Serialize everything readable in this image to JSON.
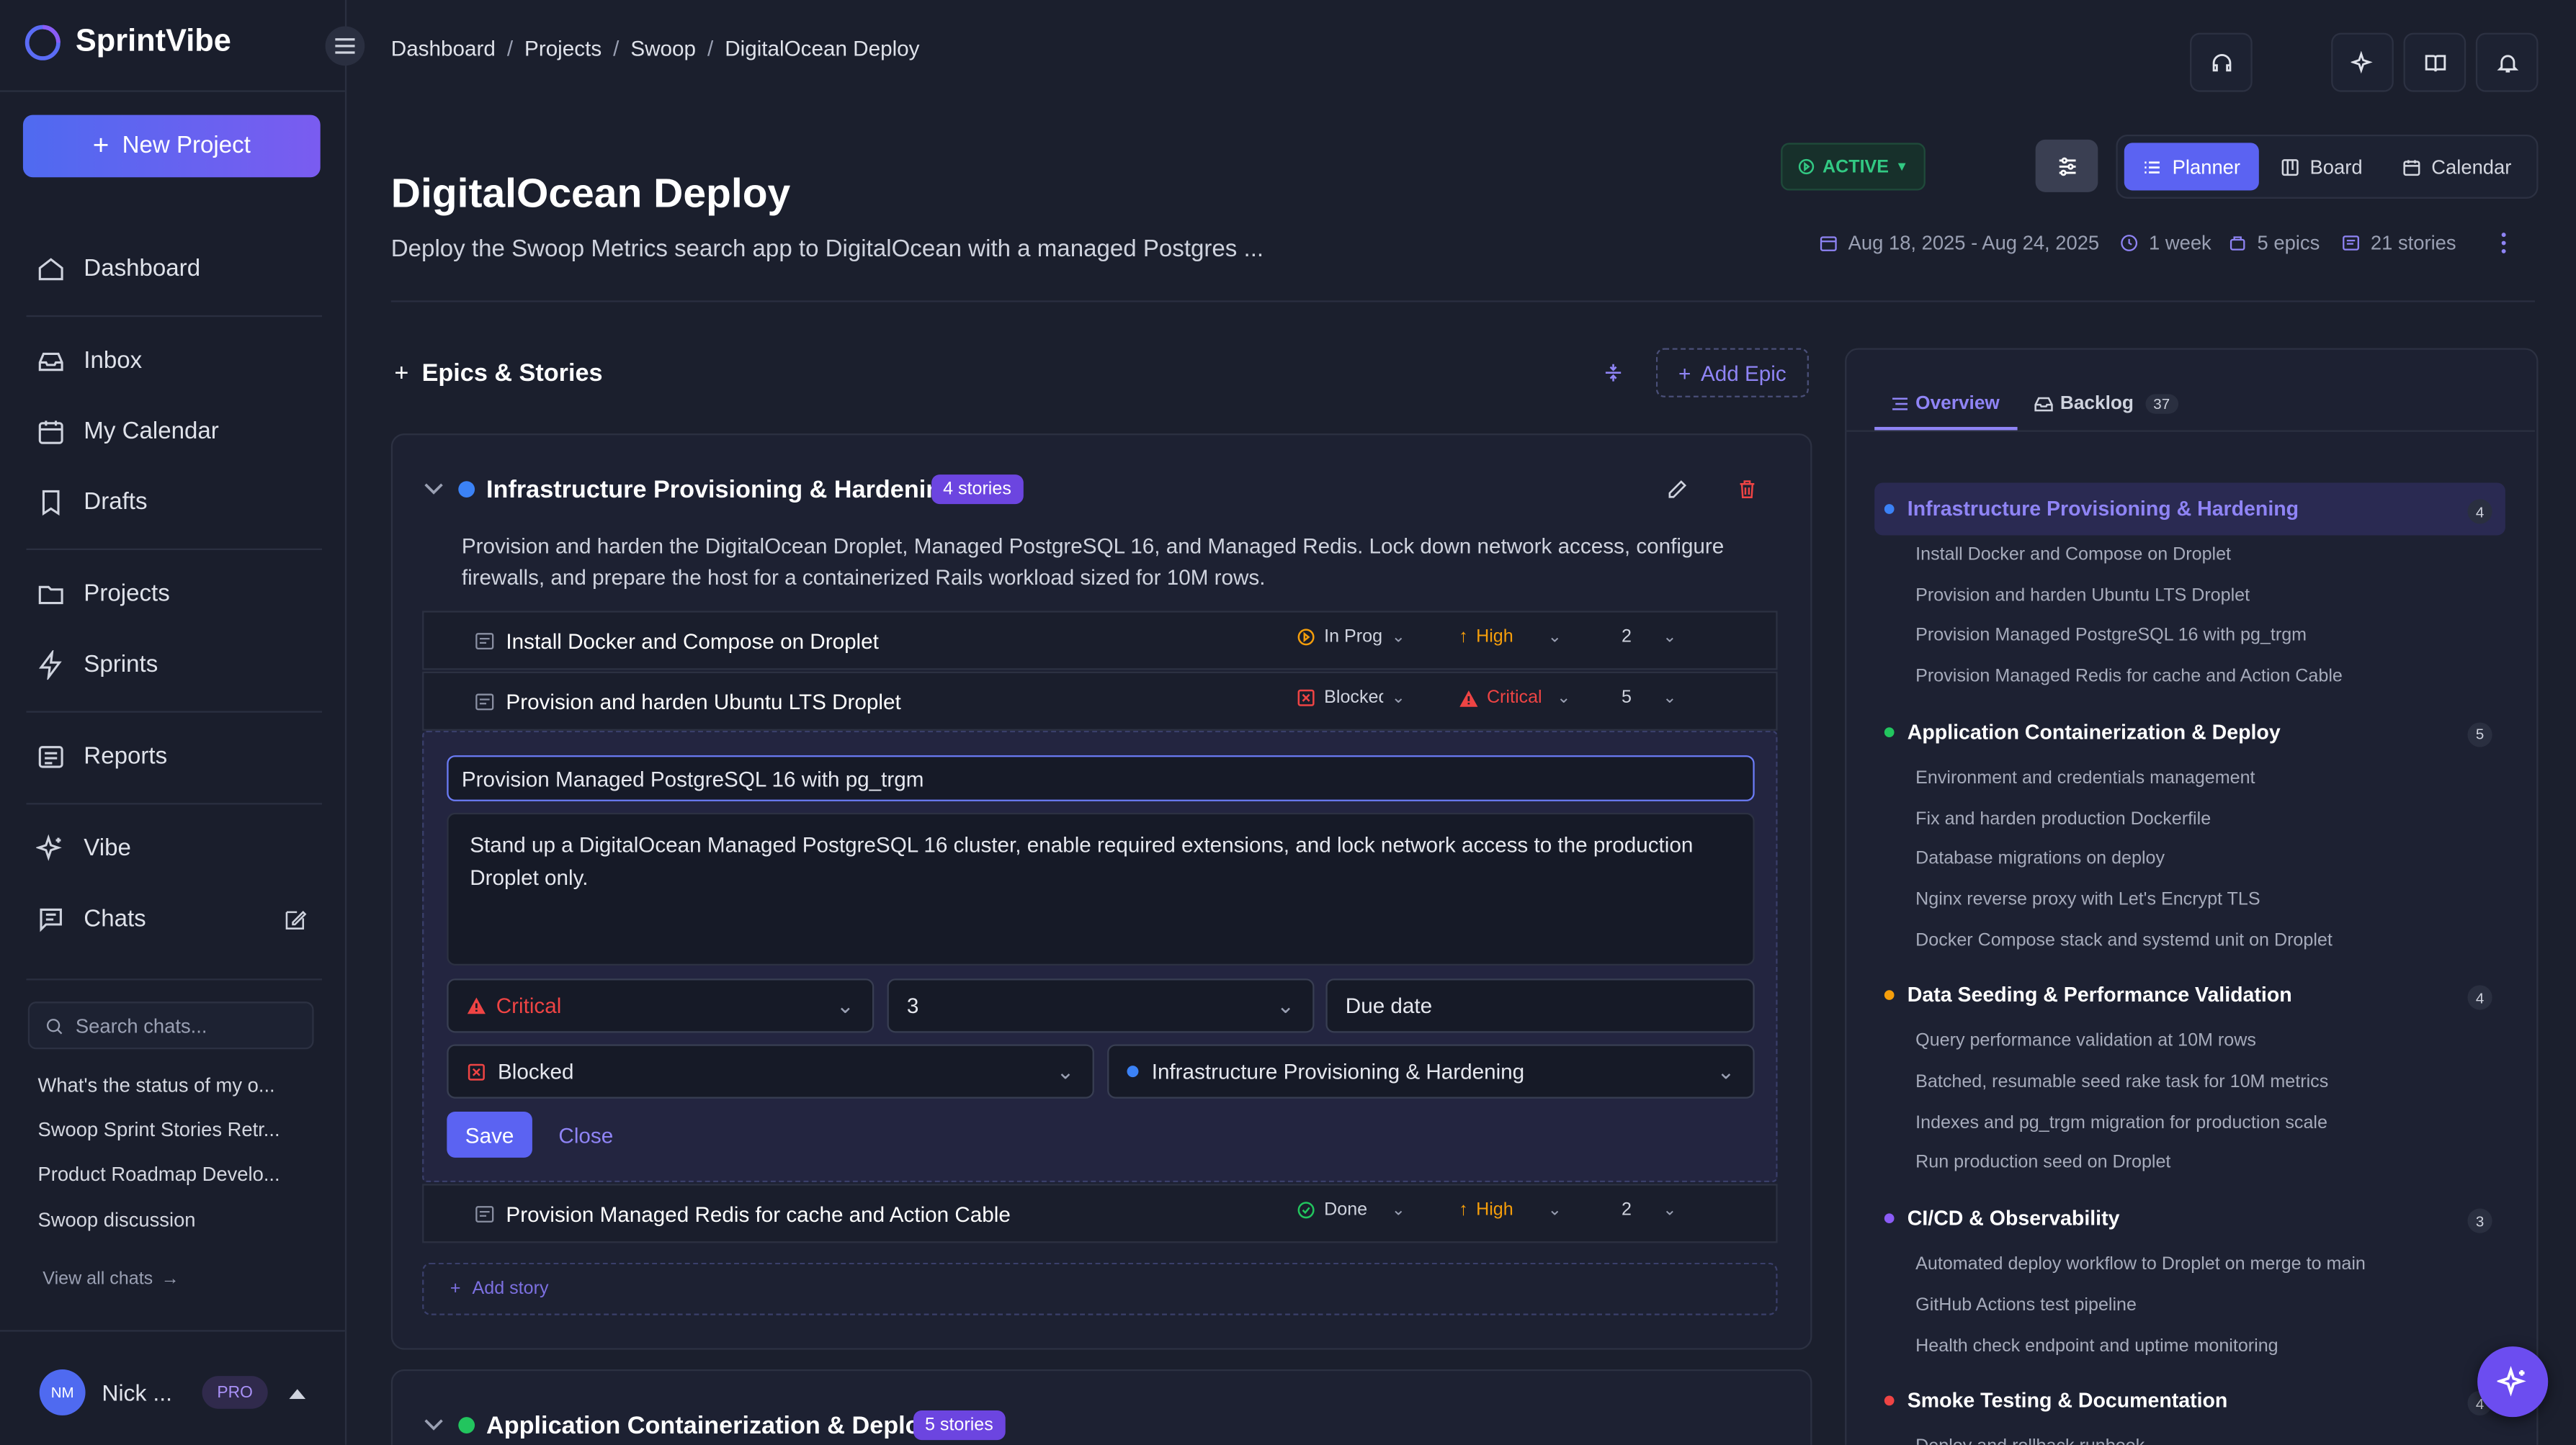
{
  "brand": {
    "name": "SprintVibe"
  },
  "sidebar": {
    "new_project": "New Project",
    "nav": [
      {
        "label": "Dashboard"
      },
      {
        "label": "Inbox"
      },
      {
        "label": "My Calendar"
      },
      {
        "label": "Drafts"
      },
      {
        "label": "Projects"
      },
      {
        "label": "Sprints"
      },
      {
        "label": "Reports"
      },
      {
        "label": "Vibe"
      },
      {
        "label": "Chats"
      }
    ],
    "search_placeholder": "Search chats...",
    "chats": [
      "What's the status of my o...",
      "Swoop Sprint Stories Retr...",
      "Product Roadmap Develo...",
      "Swoop discussion"
    ],
    "view_all": "View all chats",
    "user": {
      "initials": "NM",
      "name": "Nick ...",
      "plan": "PRO"
    }
  },
  "breadcrumb": [
    "Dashboard",
    "Projects",
    "Swoop",
    "DigitalOcean Deploy"
  ],
  "project": {
    "title": "DigitalOcean Deploy",
    "description": "Deploy the Swoop Metrics search app to DigitalOcean with a managed Postgres ...",
    "status": "ACTIVE",
    "dates": "Aug 18, 2025 - Aug 24, 2025",
    "duration": "1 week",
    "epics": "5 epics",
    "stories": "21 stories"
  },
  "views": [
    "Planner",
    "Board",
    "Calendar"
  ],
  "epics_header": {
    "title": "Epics & Stories",
    "add_epic": "Add Epic"
  },
  "epic1": {
    "title": "Infrastructure Provisioning & Hardening",
    "count": "4 stories",
    "description": "Provision and harden the DigitalOcean Droplet, Managed PostgreSQL 16, and Managed Redis. Lock down network access, configure firewalls, and prepare the host for a containerized Rails workload sized for 10M rows.",
    "stories": [
      {
        "title": "Install Docker and Compose on Droplet",
        "status": "In Prog",
        "priority": "High",
        "points": "2"
      },
      {
        "title": "Provision and harden Ubuntu LTS Droplet",
        "status": "Blocked",
        "priority": "Critical",
        "points": "5"
      },
      {
        "title": "Provision Managed Redis for cache and Action Cable",
        "status": "Done",
        "priority": "High",
        "points": "2"
      }
    ],
    "add_story": "Add story"
  },
  "editor": {
    "title_value": "Provision Managed PostgreSQL 16 with pg_trgm",
    "description_value": "Stand up a DigitalOcean Managed PostgreSQL 16 cluster, enable required extensions, and lock network access to the production Droplet only.",
    "priority": "Critical",
    "points": "3",
    "due_placeholder": "Due date",
    "status": "Blocked",
    "epic": "Infrastructure Provisioning & Hardening",
    "save": "Save",
    "close": "Close"
  },
  "epic2": {
    "title": "Application Containerization & Deploy",
    "count": "5 stories"
  },
  "right_panel": {
    "tabs": [
      {
        "label": "Overview"
      },
      {
        "label": "Backlog",
        "count": "37"
      }
    ],
    "epics": [
      {
        "title": "Infrastructure Provisioning & Hardening",
        "count": "4",
        "color": "#3b82f6",
        "stories": [
          "Install Docker and Compose on Droplet",
          "Provision and harden Ubuntu LTS Droplet",
          "Provision Managed PostgreSQL 16 with pg_trgm",
          "Provision Managed Redis for cache and Action Cable"
        ]
      },
      {
        "title": "Application Containerization & Deploy",
        "count": "5",
        "color": "#22c55e",
        "stories": [
          "Environment and credentials management",
          "Fix and harden production Dockerfile",
          "Database migrations on deploy",
          "Nginx reverse proxy with Let's Encrypt TLS",
          "Docker Compose stack and systemd unit on Droplet"
        ]
      },
      {
        "title": "Data Seeding & Performance Validation",
        "count": "4",
        "color": "#f59e0b",
        "stories": [
          "Query performance validation at 10M rows",
          "Batched, resumable seed rake task for 10M metrics",
          "Indexes and pg_trgm migration for production scale",
          "Run production seed on Droplet"
        ]
      },
      {
        "title": "CI/CD & Observability",
        "count": "3",
        "color": "#8b5cf6",
        "stories": [
          "Automated deploy workflow to Droplet on merge to main",
          "GitHub Actions test pipeline",
          "Health check endpoint and uptime monitoring"
        ]
      },
      {
        "title": "Smoke Testing & Documentation",
        "count": "4",
        "color": "#ef4444",
        "stories": [
          "Deploy and rollback runbook"
        ]
      }
    ]
  }
}
